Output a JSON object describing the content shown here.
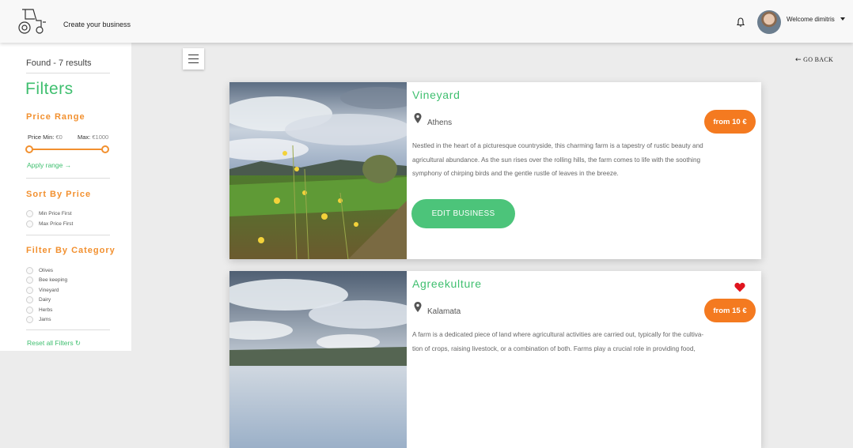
{
  "header": {
    "nav_link": "Create your business",
    "welcome": "Welcome dimitris"
  },
  "sidebar": {
    "found": "Found - 7 results",
    "filters_title": "Filters",
    "price_range": {
      "title": "Price Range",
      "min_label": "Price Min:",
      "min_value": "€0",
      "max_label": "Max:",
      "max_value": "€1000",
      "apply": "Apply range →"
    },
    "sort": {
      "title": "Sort By Price",
      "options": [
        "Min Price First",
        "Max Price First"
      ]
    },
    "category": {
      "title": "Filter By Category",
      "options": [
        "Olives",
        "Bee keeping",
        "Vineyard",
        "Dairy",
        "Herbs",
        "Jams"
      ]
    },
    "reset": "Reset all Filters ↻"
  },
  "main": {
    "go_back": "GO BACK",
    "cards": [
      {
        "title": "Vineyard",
        "location": "Athens",
        "price": "from 10 €",
        "description_lines": [
          "Nestled in the heart of a picturesque countryside, this charming farm is a tapestry of rustic beauty and",
          "agricultural abundance. As the sun rises over the rolling hills, the farm comes to life with the soothing",
          "symphony of chirping birds and the gentle rustle of leaves in the breeze."
        ],
        "button": "EDIT BUSINESS",
        "favorite": false
      },
      {
        "title": "Agreekulture",
        "location": "Kalamata",
        "price": "from 15 €",
        "description_lines": [
          "A farm is a dedicated piece of land where agricultural activities are carried out, typically for the cultiva-",
          "tion of crops, raising livestock, or a combination of both. Farms play a crucial role in providing food,"
        ],
        "button": "",
        "favorite": true
      }
    ]
  },
  "colors": {
    "accent_green": "#3fbf6f",
    "accent_orange": "#f2902f",
    "badge_orange": "#f47a20",
    "heart_red": "#e0141e"
  },
  "icons": [
    "tractor-logo-icon",
    "bell-icon",
    "caret-down-icon",
    "menu-icon",
    "arrow-left-icon",
    "location-pin-icon",
    "heart-icon"
  ]
}
